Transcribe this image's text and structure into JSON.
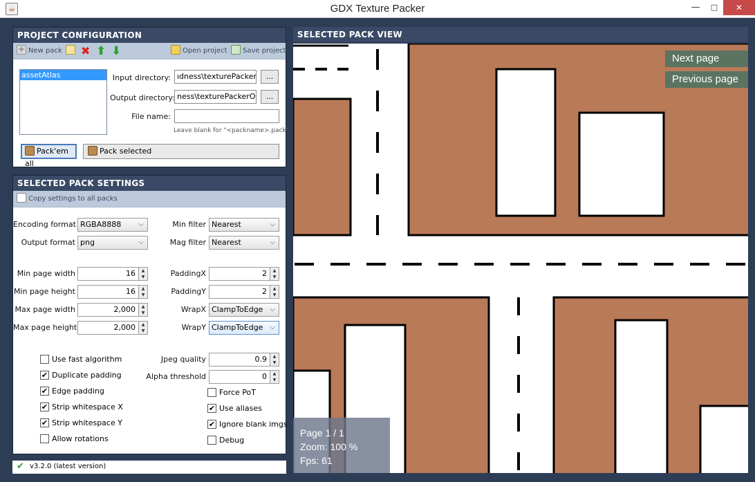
{
  "window": {
    "title": "GDX Texture Packer",
    "minimize": "—",
    "maximize": "□",
    "close": "✕"
  },
  "project": {
    "header": "PROJECT CONFIGURATION",
    "toolbar": {
      "new_pack": "New pack",
      "open_project": "Open project",
      "save_project": "Save project"
    },
    "packs": [
      "assetAtlas"
    ],
    "input_dir_label": "Input directory:",
    "input_dir_value": "ıdness\\texturePackerIn",
    "output_dir_label": "Output directory:",
    "output_dir_value": "ness\\texturePackerOut",
    "browse": "...",
    "filename_label": "File name:",
    "filename_value": "",
    "filename_hint": "Leave blank for \"<packname>.pack\"",
    "pack_all": "Pack'em all",
    "pack_selected": "Pack selected"
  },
  "settings": {
    "header": "SELECTED PACK SETTINGS",
    "copy_settings": "Copy settings to all packs",
    "encoding_format_label": "Encoding format",
    "encoding_format": "RGBA8888",
    "output_format_label": "Output format",
    "output_format": "png",
    "min_filter_label": "Min filter",
    "min_filter": "Nearest",
    "mag_filter_label": "Mag filter",
    "mag_filter": "Nearest",
    "min_page_width_label": "Min page width",
    "min_page_width": "16",
    "min_page_height_label": "Min page height",
    "min_page_height": "16",
    "max_page_width_label": "Max page width",
    "max_page_width": "2,000",
    "max_page_height_label": "Max page height",
    "max_page_height": "2,000",
    "padding_x_label": "PaddingX",
    "padding_x": "2",
    "padding_y_label": "PaddingY",
    "padding_y": "2",
    "wrap_x_label": "WrapX",
    "wrap_x": "ClampToEdge",
    "wrap_y_label": "WrapY",
    "wrap_y": "ClampToEdge",
    "jpeg_quality_label": "Jpeg quality",
    "jpeg_quality": "0.9",
    "alpha_threshold_label": "Alpha threshold",
    "alpha_threshold": "0",
    "checks_left": [
      {
        "label": "Use fast algorithm",
        "checked": false
      },
      {
        "label": "Duplicate padding",
        "checked": true
      },
      {
        "label": "Edge padding",
        "checked": true
      },
      {
        "label": "Strip whitespace X",
        "checked": true
      },
      {
        "label": "Strip whitespace Y",
        "checked": true
      },
      {
        "label": "Allow rotations",
        "checked": false
      }
    ],
    "checks_right": [
      {
        "label": "Force PoT",
        "checked": false
      },
      {
        "label": "Use aliases",
        "checked": true
      },
      {
        "label": "Ignore blank imgs",
        "checked": true
      },
      {
        "label": "Debug",
        "checked": false
      }
    ]
  },
  "status": {
    "version": "v3.2.0 (latest version)"
  },
  "view": {
    "header": "SELECTED PACK VIEW",
    "next_page": "Next page",
    "previous_page": "Previous page",
    "page": "Page 1 / 1",
    "zoom": "Zoom: 100 %",
    "fps": "Fps: 61"
  },
  "colors": {
    "panel_header": "#3a4a66",
    "background": "#2e3d56",
    "ground": "#b97a58",
    "nav_button": "#5b7361",
    "selection": "#3399ff"
  }
}
